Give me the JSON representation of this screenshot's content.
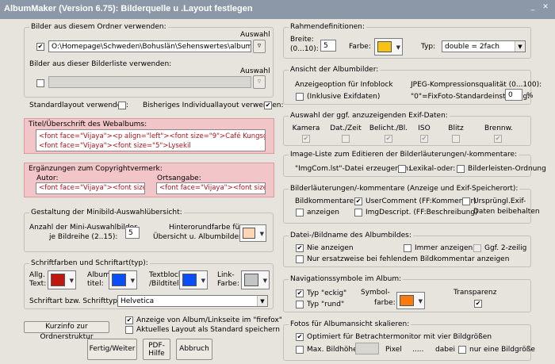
{
  "window": {
    "title": "AlbumMaker (Version 6.75): Bilderquelle u .Layout festlegen"
  },
  "left": {
    "folder": {
      "label": "Bilder aus diesem Ordner verwenden:",
      "auswahl": "Auswahl",
      "path": "O:\\Homepage\\Schweden\\Bohuslän\\Sehenswertes\\album_bilder",
      "checked": true
    },
    "list": {
      "label": "Bilder aus dieser Bilderliste verwenden:",
      "auswahl": "Auswahl",
      "path": "",
      "checked": false
    },
    "standard": {
      "label": "Standardlayout verwenden:",
      "checked": false
    },
    "individual": {
      "label": "Bisheriges Individuallayout verwenden:",
      "checked": true
    },
    "titel": {
      "label": "Titel/Überschrift des Webalbums:",
      "line1": "<font face=\"Vijaya\"><p align=\"left\"><font size=\"9\">Café Kungsgatan",
      "line2": "<font face=\"Vijaya\"><font size=\"5\">Lysekil"
    },
    "copyright": {
      "label": "Ergänzungen zum Copyrightvermerk:",
      "autor_label": "Autor:",
      "autor": "<font face=\"Vijaya\"><font size=",
      "ort_label": "Ortsangabe:",
      "ort": "<font face=\"Vijaya\"><font size="
    },
    "mini": {
      "label": "Gestaltung der Minibild-Auswahlübersicht:",
      "count_label1": "Anzahl der Mini-Auswahlbilder",
      "count_label2": "je Bildreihe (2..15):",
      "count": "5",
      "bg_label1": "Hinterorundfarbe für",
      "bg_label2": "Übersicht u. Albumbilder:",
      "bg_color": "#fdd5b2"
    },
    "fonts": {
      "label": "Schriftfarben und Schriftart(typ):",
      "c1a": "Allg.",
      "c1b": "Text:",
      "c1": "#c0170e",
      "c2a": "Album-",
      "c2b": "titel:",
      "c2": "#0b4ef5",
      "c3a": "Textblock",
      "c3b": "/Bildtitel:",
      "c3": "#0b4ef5",
      "c4a": "Link-",
      "c4b": "Farbe:",
      "c4": "#c4c4c4",
      "font_label": "Schriftart bzw. Schrifttyp:",
      "font": "Helvetica"
    },
    "kurzinfo": "Kurzinfo zur Ordnerstruktur",
    "firefox": {
      "label": "Anzeige von Album/Linkseite im \"firefox\"",
      "checked": true
    },
    "aktuell": {
      "label": "Aktuelles Layout als Standard speichern",
      "checked": false
    },
    "fertig": "Fertig/Weiter",
    "pdf1": "PDF-",
    "pdf2": "Hilfe",
    "abbruch": "Abbruch"
  },
  "right": {
    "rahmen": {
      "label": "Rahmendefinitionen:",
      "breite1": "Breite:",
      "breite2": "(0...10):",
      "breite": "5",
      "farbe": "Farbe:",
      "color": "#f7c213",
      "typ": "Typ:",
      "typ_value": "double = 2fach"
    },
    "ansicht": {
      "label": "Ansicht der Albumbilder:",
      "infoblock": "Anzeigeoption für Infoblock",
      "inkl": "(Inklusive Exifdaten)",
      "jpeg1": "JPEG-Kompressionsqualität (0...100):",
      "jpeg2": "\"0\"=FixFoto-Standardeinstellung:",
      "jpeg": "0",
      "pct": "%",
      "inkl_checked": false
    },
    "exif": {
      "label": "Auswahl der ggf. anzuzeigenden Exif-Daten:",
      "cols": [
        "Kamera",
        "Dat./Zeit",
        "Belicht./Bl.",
        "ISO",
        "Blitz",
        "Brennw."
      ],
      "checked": [
        true,
        false,
        true,
        true,
        false,
        true
      ]
    },
    "imgliste": {
      "label": "Image-Liste zum Editieren der Bilderläuterungen/-kommentare:",
      "text": "\"ImgCom.lst\"-Datei erzeugen in:",
      "lexikal": "Lexikal-",
      "oder": "oder:",
      "bild": "Bilderleisten-Ordnung"
    },
    "bilderl": {
      "label": "Bilderläuterungen/-kommentare (Anzeige und Exif-Speicherort):",
      "bk": "Bildkommentare",
      "anz": "anzeigen",
      "uc": "UserComment (FF:Kommentar)",
      "ud": "ImgDescript. (FF:Beschreibung)",
      "ur1": "Ursprüngl.Exif-",
      "ur2": "Daten beibehalten"
    },
    "datei": {
      "label": "Datei-/Bildname des Albumbildes:",
      "nie": "Nie anzeigen",
      "immer": "Immer anzeigen",
      "zwei": "Ggf. 2-zeilig",
      "nur": "Nur ersatzweise bei fehlendem Bildkommentar anzeigen"
    },
    "navi": {
      "label": "Navigationssymbole im Album:",
      "eckig": "Typ \"eckig\"",
      "rund": "Typ \"rund\"",
      "symbol1": "Symbol-",
      "symbol2": "farbe:",
      "color": "#fa7a0e",
      "trans": "Transparenz"
    },
    "fotos": {
      "label": "Fotos für Albumansicht skalieren:",
      "opt": "Optimiert für Betrachtermonitor mit vier Bildgrößen",
      "max": "Max. Bildhöhe:",
      "pixel": "Pixel",
      "dots": ".....",
      "dabei": "dabei",
      "nur": "nur eine Bildgröße"
    }
  }
}
